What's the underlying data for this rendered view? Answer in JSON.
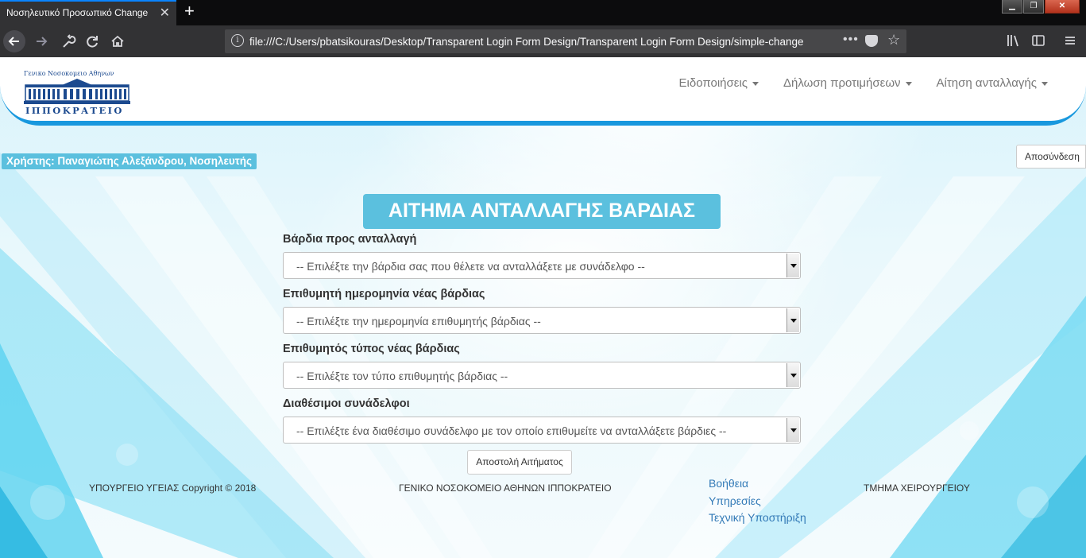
{
  "browser": {
    "tab_title": "Νοσηλευτικό Προσωπικό Change",
    "tab_close": "✕",
    "new_tab": "+",
    "url": "file:///C:/Users/pbatsikouras/Desktop/Transparent Login Form Design/Transparent Login Form Design/simple-change"
  },
  "header": {
    "logo_top": "Γενικο Νοσοκομειο Αθηνων",
    "logo_bottom": "ΙΠΠΟΚΡΑΤΕΙΟ",
    "menu": [
      {
        "label": "Ειδοποιήσεις"
      },
      {
        "label": "Δήλωση προτιμήσεων"
      },
      {
        "label": "Αίτηση ανταλλαγής"
      }
    ]
  },
  "user_label": "Χρήστης: Παναγιώτης Αλεξάνδρου, Νοσηλευτής",
  "logout_label": "Αποσύνδεση",
  "form": {
    "title": "ΑΙΤΗΜΑ ΑΝΤΑΛΛΑΓΗΣ ΒΑΡΔΙΑΣ",
    "fields": [
      {
        "label": "Βάρδια προς ανταλλαγή",
        "selected": "-- Επιλέξτε την βάρδια σας που θέλετε να ανταλλάξετε με συνάδελφο --"
      },
      {
        "label": "Επιθυμητή ημερομηνία νέας βάρδιας",
        "selected": "-- Επιλέξτε την ημερομηνία επιθυμητής βάρδιας --"
      },
      {
        "label": "Επιθυμητός τύπος νέας βάρδιας",
        "selected": "-- Επιλέξτε τον τύπο επιθυμητής βάρδιας --"
      },
      {
        "label": "Διαθέσιμοι συνάδελφοι",
        "selected": "-- Επιλέξτε ένα διαθέσιμο συνάδελφο με τον οποίο επιθυμείτε να ανταλλάξετε βάρδιες --"
      }
    ],
    "submit_label": "Αποστολή Αιτήματος"
  },
  "footer": {
    "copyright": "ΥΠΟΥΡΓΕΙΟ ΥΓΕΙΑΣ Copyright © 2018",
    "hospital": "ΓΕΝΙΚΟ ΝΟΣΟΚΟΜΕΙΟ ΑΘΗΝΩΝ ΙΠΠΟΚΡΑΤΕΙΟ",
    "links": [
      "Βοήθεια",
      "Υπηρεσίες",
      "Τεχνική Υποστήριξη"
    ],
    "department": "ΤΜΗΜΑ ΧΕΙΡΟΥΡΓΕΙΟΥ"
  },
  "colors": {
    "accent": "#5bc0de",
    "header_band": "#1898de",
    "link": "#337ab7",
    "browser_tab_highlight": "#0a84ff"
  }
}
